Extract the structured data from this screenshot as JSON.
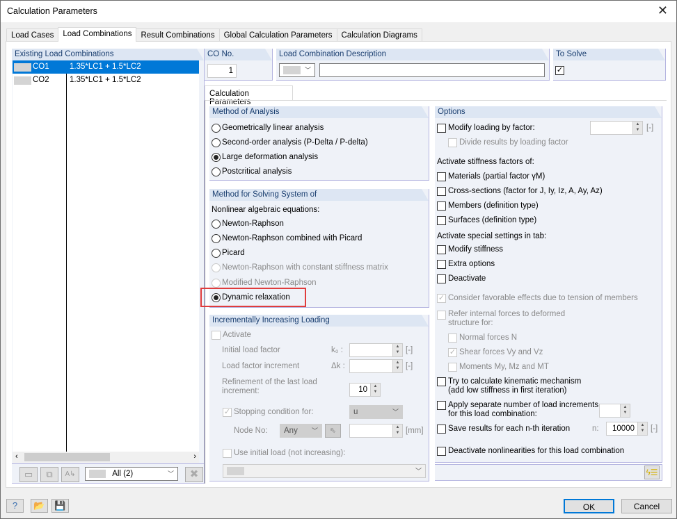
{
  "window": {
    "title": "Calculation Parameters",
    "close_icon": "close-icon"
  },
  "tabs": [
    "Load Cases",
    "Load Combinations",
    "Result Combinations",
    "Global Calculation Parameters",
    "Calculation Diagrams"
  ],
  "active_tab": "Load Combinations",
  "existing": {
    "header": "Existing Load Combinations",
    "rows": [
      {
        "id": "CO1",
        "desc": "1.35*LC1 + 1.5*LC2",
        "selected": true
      },
      {
        "id": "CO2",
        "desc": "1.35*LC1 + 1.5*LC2",
        "selected": false
      }
    ],
    "filter": "All (2)"
  },
  "co_no": {
    "header": "CO No.",
    "value": "1"
  },
  "description": {
    "header": "Load Combination Description",
    "value": ""
  },
  "to_solve": {
    "header": "To Solve",
    "checked": true
  },
  "subtab": "Calculation Parameters",
  "method_analysis": {
    "header": "Method of Analysis",
    "options": [
      "Geometrically linear analysis",
      "Second-order analysis (P-Delta / P-delta)",
      "Large deformation analysis",
      "Postcritical analysis"
    ],
    "selected": "Large deformation analysis"
  },
  "method_solving": {
    "header": "Method for Solving System of",
    "sublabel": "Nonlinear algebraic equations:",
    "options": [
      "Newton-Raphson",
      "Newton-Raphson combined with Picard",
      "Picard",
      "Newton-Raphson with constant stiffness matrix",
      "Modified Newton-Raphson",
      "Dynamic relaxation"
    ],
    "disabled": [
      "Newton-Raphson with constant stiffness matrix",
      "Modified Newton-Raphson"
    ],
    "selected": "Dynamic relaxation"
  },
  "incremental": {
    "header": "Incrementally Increasing Loading",
    "activate": "Activate",
    "initial_factor": "Initial load factor",
    "k0": "k₀ :",
    "unit1": "[-]",
    "increment": "Load factor increment",
    "dk": "Δk :",
    "unit2": "[-]",
    "refinement": "Refinement of the last load increment:",
    "refinement_value": "10",
    "stopping": "Stopping condition for:",
    "stopping_value": "u",
    "node_no": "Node No:",
    "node_value": "Any",
    "unit3": "[mm]",
    "use_initial": "Use initial load (not increasing):"
  },
  "options": {
    "header": "Options",
    "modify_loading": "Modify loading by factor:",
    "unit": "[-]",
    "divide": "Divide results by loading factor",
    "stiffness_label": "Activate stiffness factors of:",
    "stiffness": [
      "Materials (partial factor γM)",
      "Cross-sections (factor for J, Iy, Iz, A, Ay, Az)",
      "Members (definition type)",
      "Surfaces (definition type)"
    ],
    "special_label": "Activate special settings in tab:",
    "special": [
      "Modify stiffness",
      "Extra options",
      "Deactivate"
    ],
    "favorable": "Consider favorable effects due to tension of members",
    "refer": "Refer internal forces to deformed structure for:",
    "refer_items": [
      "Normal forces N",
      "Shear forces Vy and Vz",
      "Moments My, Mz and MT"
    ],
    "kinematic": "Try to calculate kinematic mechanism (add low stiffness in first iteration)",
    "separate": "Apply separate number of load increments for this load combination:",
    "save_nth": "Save results for each n-th iteration",
    "n_label": "n:",
    "n_value": "10000",
    "n_unit": "[-]",
    "deactivate_nl": "Deactivate nonlinearities for this load combination"
  },
  "footer": {
    "ok": "OK",
    "cancel": "Cancel"
  }
}
